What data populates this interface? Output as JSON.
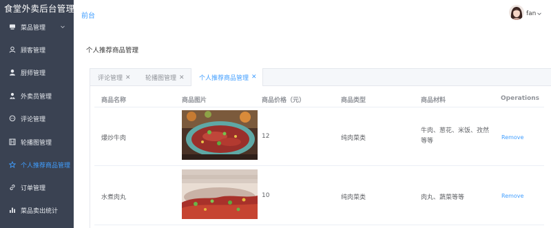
{
  "sidebar": {
    "title": "食堂外卖后台管理",
    "items": [
      {
        "label": "菜品管理",
        "icon": "dish-icon"
      },
      {
        "label": "顾客管理",
        "icon": "user-icon"
      },
      {
        "label": "厨师管理",
        "icon": "chef-icon"
      },
      {
        "label": "外卖员管理",
        "icon": "courier-icon"
      },
      {
        "label": "评论管理",
        "icon": "comment-icon"
      },
      {
        "label": "轮播图管理",
        "icon": "film-icon"
      },
      {
        "label": "个人推荐商品管理",
        "icon": "star-icon"
      },
      {
        "label": "订单管理",
        "icon": "link-icon"
      },
      {
        "label": "菜品卖出统计",
        "icon": "bar-chart-icon"
      }
    ]
  },
  "header": {
    "front_link": "前台",
    "username": "fan"
  },
  "page": {
    "title": "个人推荐商品管理"
  },
  "tabs": [
    {
      "label": "评论管理"
    },
    {
      "label": "轮播图管理"
    },
    {
      "label": "个人推荐商品管理"
    }
  ],
  "table": {
    "columns": [
      "商品名称",
      "商品图片",
      "商品价格（元）",
      "商品类型",
      "商品材料",
      "Operations"
    ],
    "rows": [
      {
        "name": "爆炒牛肉",
        "price": "12",
        "type": "纯肉菜类",
        "materials": "牛肉、葱花、米饭、孜然等等",
        "action": "Remove"
      },
      {
        "name": "水煮肉丸",
        "price": "10",
        "type": "纯肉菜类",
        "materials": "肉丸、蔬菜等等",
        "action": "Remove"
      }
    ]
  },
  "colors": {
    "sidebar_bg": "#3a4252",
    "accent": "#409eff"
  }
}
